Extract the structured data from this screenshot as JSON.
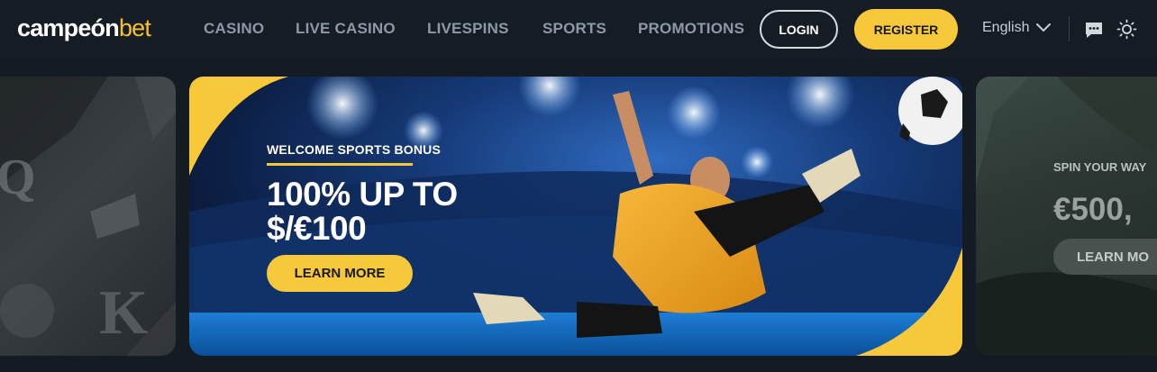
{
  "header": {
    "logo_main": "campeón",
    "logo_accent": "bet",
    "nav": [
      "CASINO",
      "LIVE CASINO",
      "LIVESPINS",
      "SPORTS",
      "PROMOTIONS"
    ],
    "login_label": "LOGIN",
    "register_label": "REGISTER",
    "language": "English",
    "icons": [
      "chevron-down-icon",
      "chat-icon",
      "sun-icon"
    ]
  },
  "banners": {
    "main": {
      "kicker": "WELCOME SPORTS BONUS",
      "title": "100% UP TO\n$/€100",
      "button": "LEARN MORE"
    },
    "right": {
      "kicker": "SPIN YOUR WAY",
      "title": "€500,",
      "button": "LEARN MO"
    }
  },
  "colors": {
    "background": "#151c24",
    "accent": "#f6c83a",
    "nav_text": "#8e98a6"
  }
}
